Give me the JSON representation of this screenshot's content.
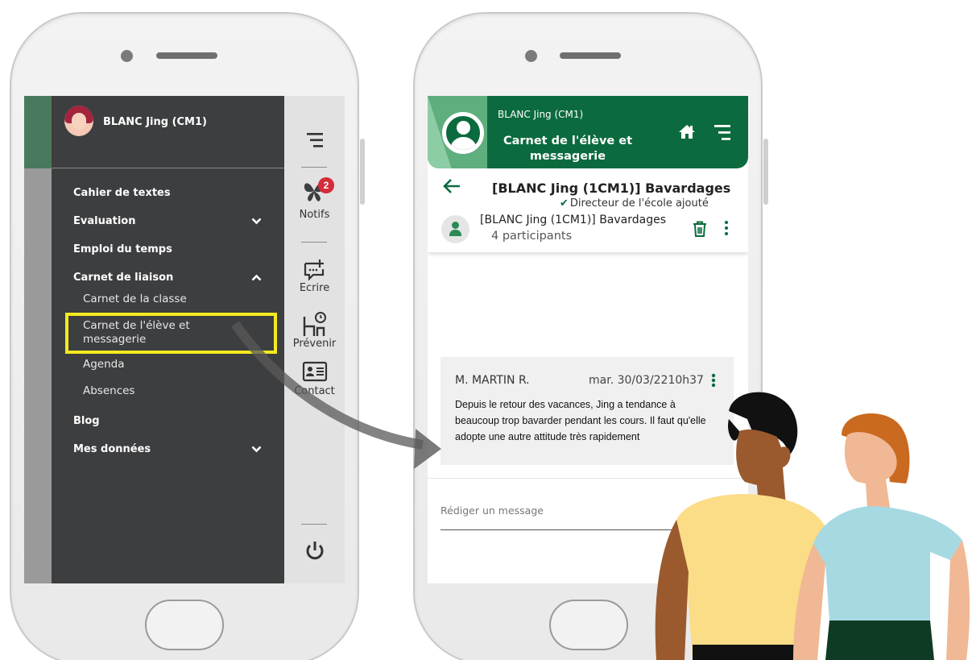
{
  "left_phone": {
    "drawer": {
      "user_name": "BLANC Jing (CM1)",
      "menu": [
        {
          "label": "Cahier de textes",
          "chevron": ""
        },
        {
          "label": "Evaluation",
          "chevron": "chevron-down"
        },
        {
          "label": "Emploi du temps",
          "chevron": ""
        },
        {
          "label": "Carnet de liaison",
          "chevron": "chevron-up"
        }
      ],
      "submenu": [
        {
          "label": "Carnet de la classe"
        },
        {
          "label": "Carnet de l'élève et"
        },
        {
          "label": "messagerie"
        },
        {
          "label": "Agenda"
        },
        {
          "label": "Absences"
        }
      ],
      "menu_bottom": [
        {
          "label": "Blog",
          "chevron": ""
        },
        {
          "label": "Mes données",
          "chevron": "chevron-down"
        }
      ]
    },
    "rail": {
      "notifs_badge": "2",
      "notifs_label": "Notifs",
      "ecrire_label": "Ecrire",
      "prevenir_label": "Prévenir",
      "contact_label": "Contact"
    }
  },
  "right_phone": {
    "header": {
      "user_name": "BLANC Jing (CM1)",
      "title_line1": "Carnet de l'élève et",
      "title_line2": "messagerie"
    },
    "conversation_title": "[BLANC Jing (1CM1)] Bavardages",
    "thread": {
      "name": "[BLANC Jing (1CM1)] Bavardages",
      "participants": "4 participants"
    },
    "message": {
      "author": "M. MARTIN R.",
      "date": "mar. 30/03/2210h37",
      "body": "Depuis le retour des vacances, Jing a tendance à beaucoup trop bavarder pendant les cours. Il faut qu'elle adopte une autre attitude très rapidement",
      "status": "Directeur de l'école ajouté"
    },
    "compose": {
      "placeholder": "Rédiger un message"
    }
  },
  "colors": {
    "brand_green": "#0b6b3e",
    "mint": "#8ccda6",
    "drawer_bg": "#3d3e40",
    "highlight": "#f4ea1e",
    "badge_red": "#d52b3a"
  }
}
